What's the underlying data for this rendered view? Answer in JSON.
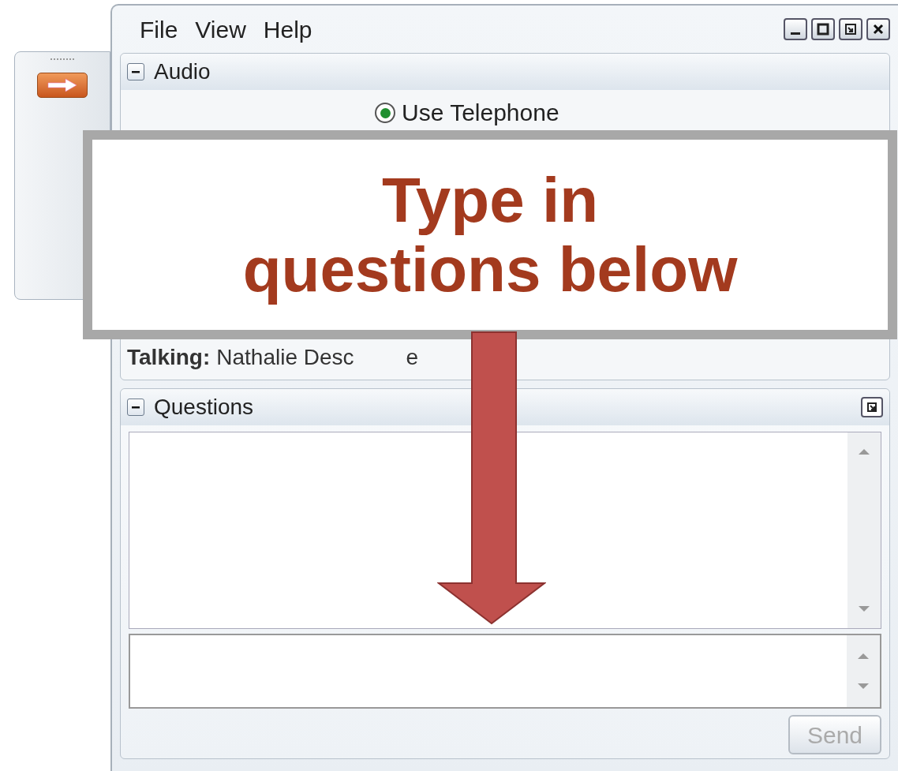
{
  "menu": [
    "File",
    "View",
    "Help"
  ],
  "audio": {
    "title": "Audio",
    "expanded": true,
    "radio": {
      "label": "Use Telephone",
      "selected": true
    },
    "talking_label": "Talking:",
    "talking_name": "Nathalie Desc",
    "talking_tail": "e"
  },
  "questions": {
    "title": "Questions",
    "expanded": true,
    "send": {
      "label": "Send",
      "disabled": true
    }
  },
  "callout": {
    "lines": [
      "Type in",
      "questions below"
    ]
  }
}
